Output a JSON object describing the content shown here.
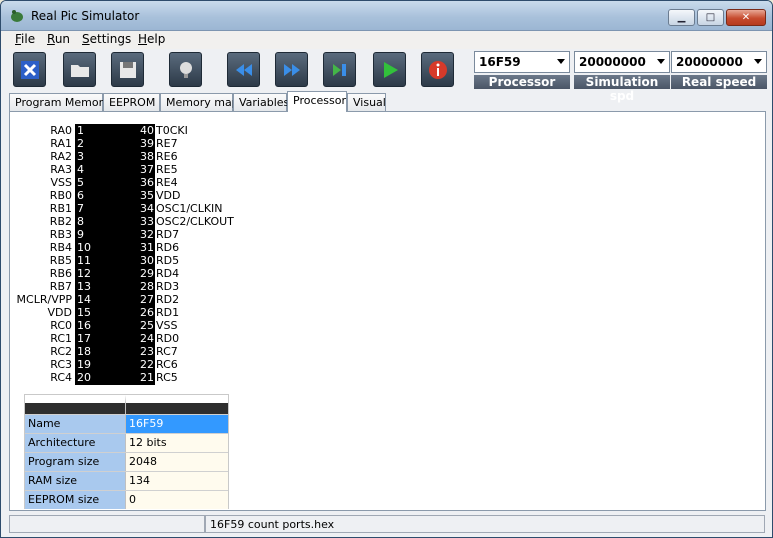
{
  "window": {
    "title": "Real Pic Simulator"
  },
  "menu": [
    "File",
    "Run",
    "Settings",
    "Help"
  ],
  "toolbar": {
    "buttons": [
      "exit-icon",
      "open-folder-icon",
      "save-icon",
      "lightbulb-icon",
      "rewind-icon",
      "fast-forward-icon",
      "step-icon",
      "play-icon",
      "info-icon"
    ],
    "processor": {
      "value": "16F59",
      "label": "Processor"
    },
    "sim_speed": {
      "value": "20000000",
      "label": "Simulation spd"
    },
    "real_speed": {
      "value": "20000000",
      "label": "Real speed"
    }
  },
  "tabs": [
    "Program Memory",
    "EEPROM",
    "Memory map",
    "Variables",
    "Processor",
    "Visual"
  ],
  "active_tab": "Processor",
  "chip": {
    "left_pins": [
      {
        "name": "RA0",
        "num": "1"
      },
      {
        "name": "RA1",
        "num": "2"
      },
      {
        "name": "RA2",
        "num": "3"
      },
      {
        "name": "RA3",
        "num": "4"
      },
      {
        "name": "VSS",
        "num": "5"
      },
      {
        "name": "RB0",
        "num": "6"
      },
      {
        "name": "RB1",
        "num": "7"
      },
      {
        "name": "RB2",
        "num": "8"
      },
      {
        "name": "RB3",
        "num": "9"
      },
      {
        "name": "RB4",
        "num": "10"
      },
      {
        "name": "RB5",
        "num": "11"
      },
      {
        "name": "RB6",
        "num": "12"
      },
      {
        "name": "RB7",
        "num": "13"
      },
      {
        "name": "MCLR/VPP",
        "num": "14"
      },
      {
        "name": "VDD",
        "num": "15"
      },
      {
        "name": "RC0",
        "num": "16"
      },
      {
        "name": "RC1",
        "num": "17"
      },
      {
        "name": "RC2",
        "num": "18"
      },
      {
        "name": "RC3",
        "num": "19"
      },
      {
        "name": "RC4",
        "num": "20"
      }
    ],
    "right_pins": [
      {
        "name": "T0CKI",
        "num": "40"
      },
      {
        "name": "RE7",
        "num": "39"
      },
      {
        "name": "RE6",
        "num": "38"
      },
      {
        "name": "RE5",
        "num": "37"
      },
      {
        "name": "RE4",
        "num": "36"
      },
      {
        "name": "VDD",
        "num": "35"
      },
      {
        "name": "OSC1/CLKIN",
        "num": "34"
      },
      {
        "name": "OSC2/CLKOUT",
        "num": "33"
      },
      {
        "name": "RD7",
        "num": "32"
      },
      {
        "name": "RD6",
        "num": "31"
      },
      {
        "name": "RD5",
        "num": "30"
      },
      {
        "name": "RD4",
        "num": "29"
      },
      {
        "name": "RD3",
        "num": "28"
      },
      {
        "name": "RD2",
        "num": "27"
      },
      {
        "name": "RD1",
        "num": "26"
      },
      {
        "name": "VSS",
        "num": "25"
      },
      {
        "name": "RD0",
        "num": "24"
      },
      {
        "name": "RC7",
        "num": "23"
      },
      {
        "name": "RC6",
        "num": "22"
      },
      {
        "name": "RC5",
        "num": "21"
      }
    ]
  },
  "properties": [
    {
      "key": "Name",
      "value": "16F59"
    },
    {
      "key": "Architecture",
      "value": "12 bits"
    },
    {
      "key": "Program size",
      "value": "2048"
    },
    {
      "key": "RAM size",
      "value": "134"
    },
    {
      "key": "EEPROM size",
      "value": "0"
    }
  ],
  "status": {
    "file": "16F59 count ports.hex"
  }
}
